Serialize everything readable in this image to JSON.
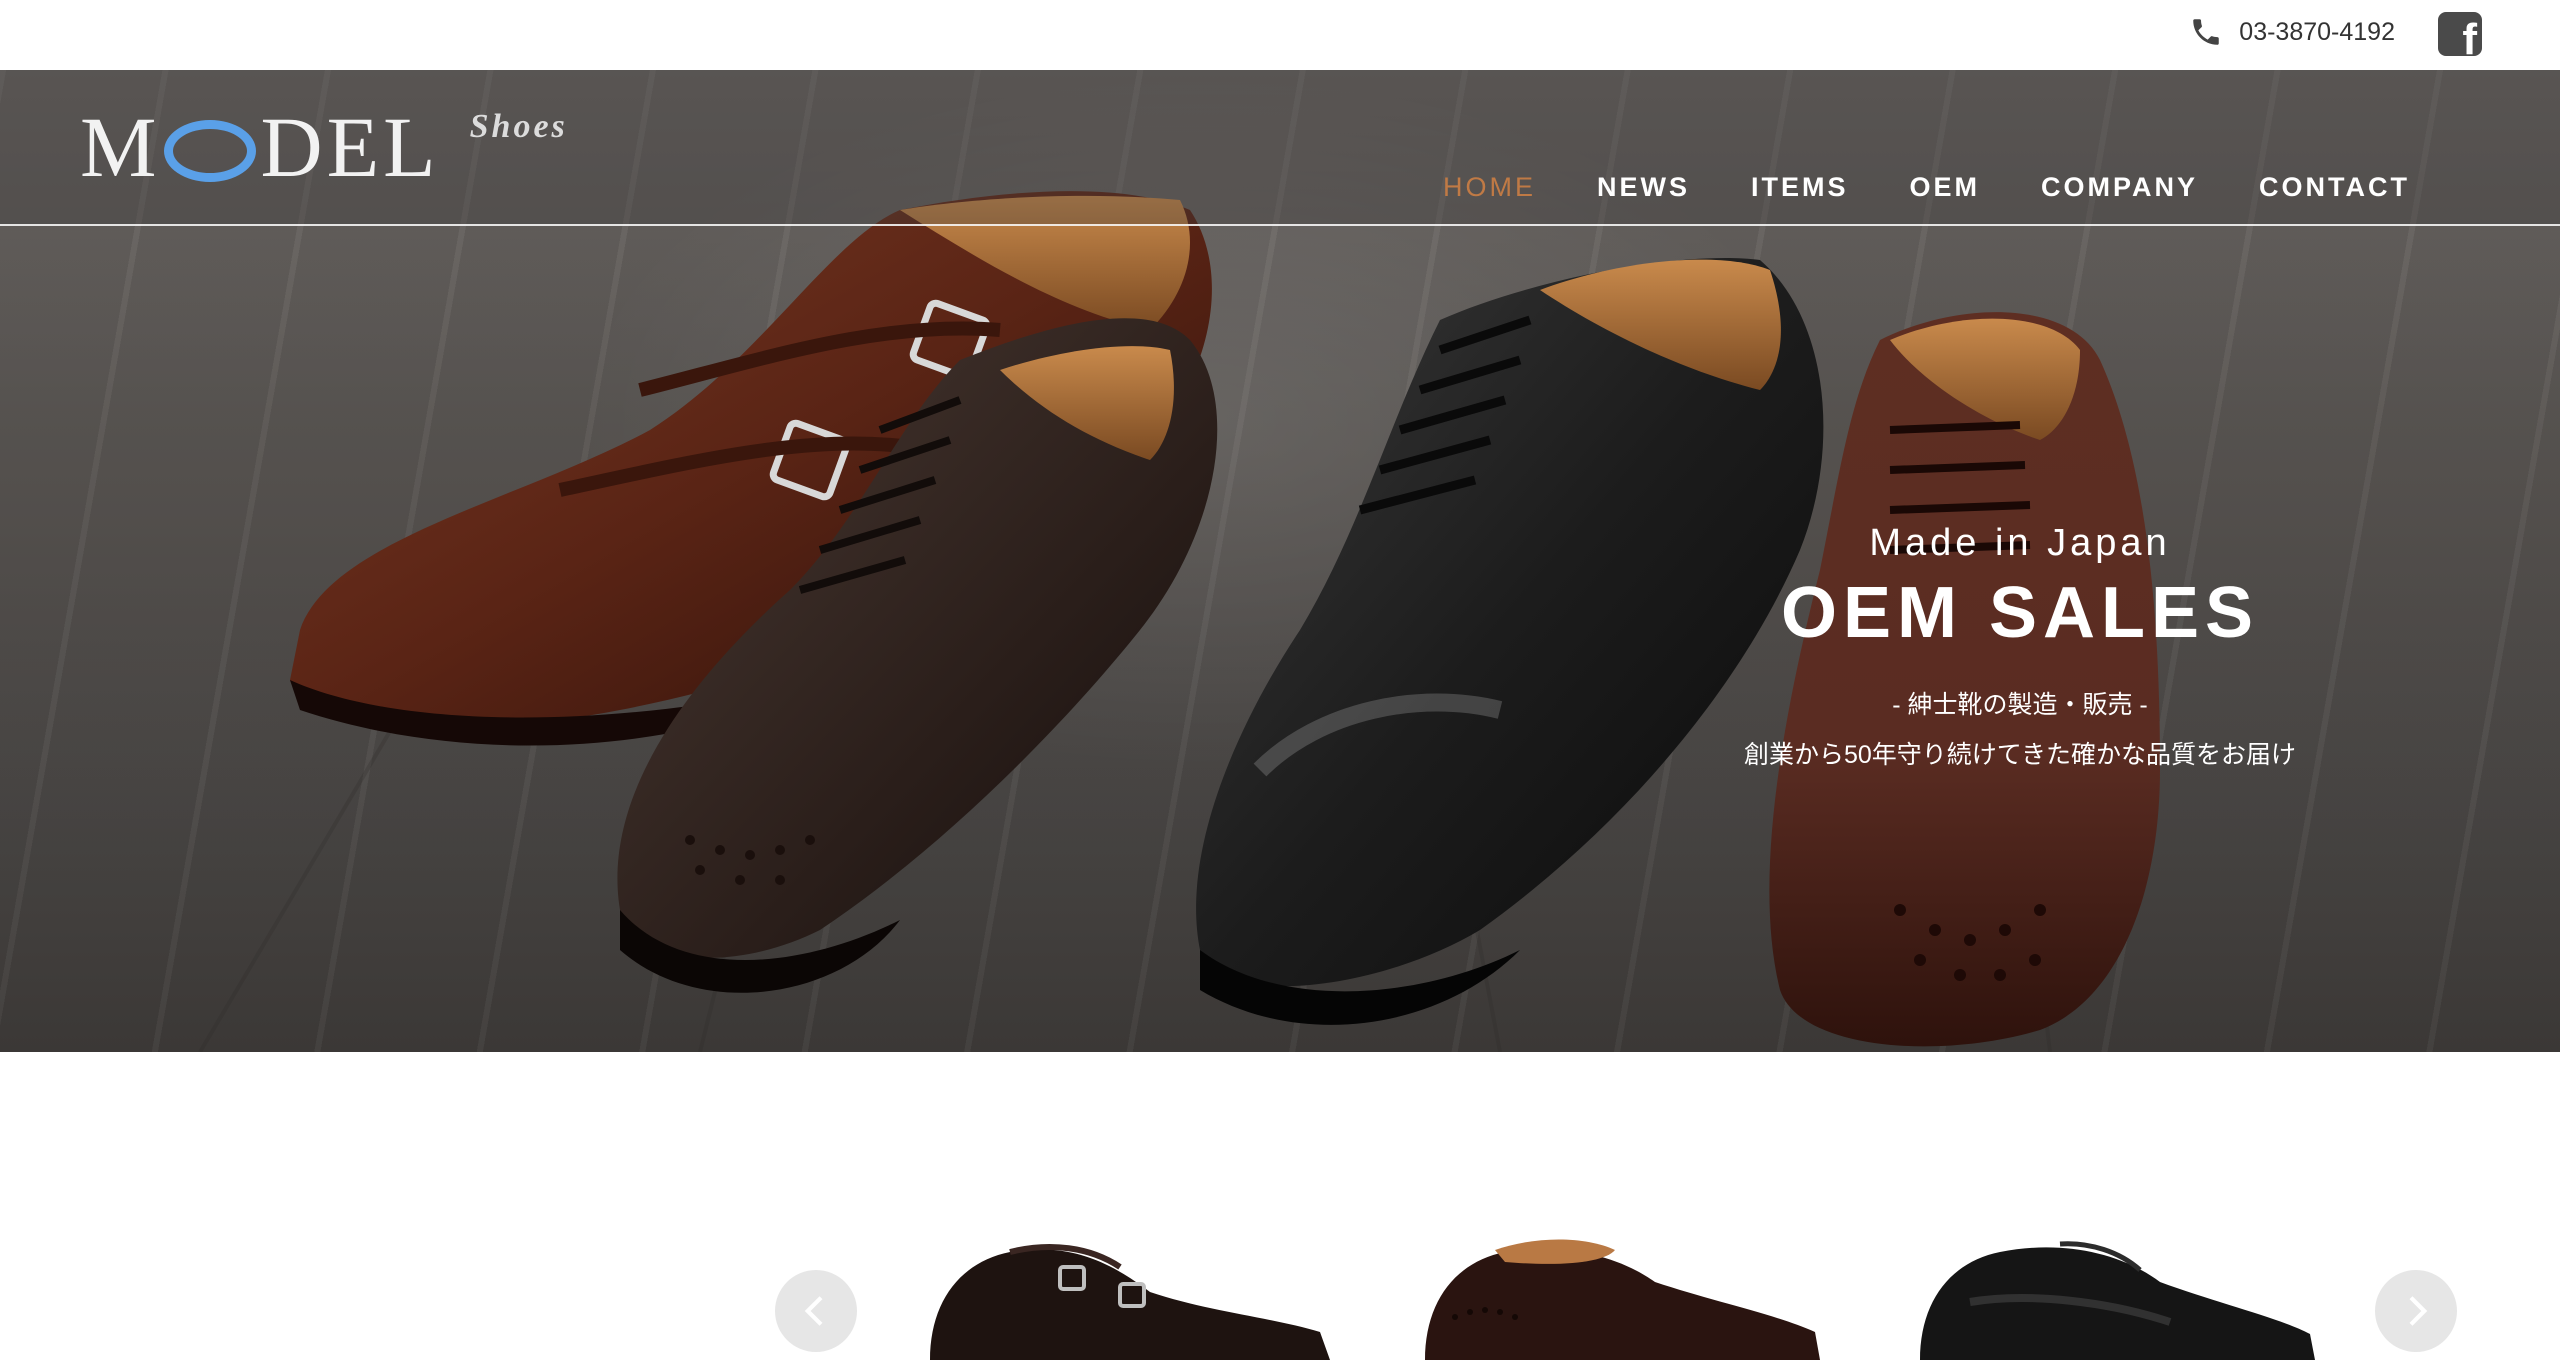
{
  "topbar": {
    "phone": "03-3870-4192",
    "phone_icon": "phone-icon",
    "social_icon": "facebook-icon"
  },
  "header": {
    "logo_main_left": "M",
    "logo_main_right": "DEL",
    "logo_sub": "Shoes",
    "nav": [
      {
        "label": "HOME",
        "active": true
      },
      {
        "label": "NEWS",
        "active": false
      },
      {
        "label": "ITEMS",
        "active": false
      },
      {
        "label": "OEM",
        "active": false
      },
      {
        "label": "COMPANY",
        "active": false
      },
      {
        "label": "CONTACT",
        "active": false
      }
    ]
  },
  "hero": {
    "tagline": "Made in Japan",
    "title": "OEM SALES",
    "subtitle1": "- 紳士靴の製造・販売 -",
    "subtitle2": "創業から50年守り続けてきた確かな品質をお届け"
  },
  "carousel": {
    "prev_icon": "chevron-left-icon",
    "next_icon": "chevron-right-icon",
    "products": [
      {
        "name": "double-monk-shoe"
      },
      {
        "name": "brogue-oxford-shoe"
      },
      {
        "name": "black-derby-shoe"
      }
    ]
  },
  "colors": {
    "accent_active_nav": "#c07a45",
    "logo_ring": "#5aa0e8",
    "hero_text": "#ffffff"
  }
}
